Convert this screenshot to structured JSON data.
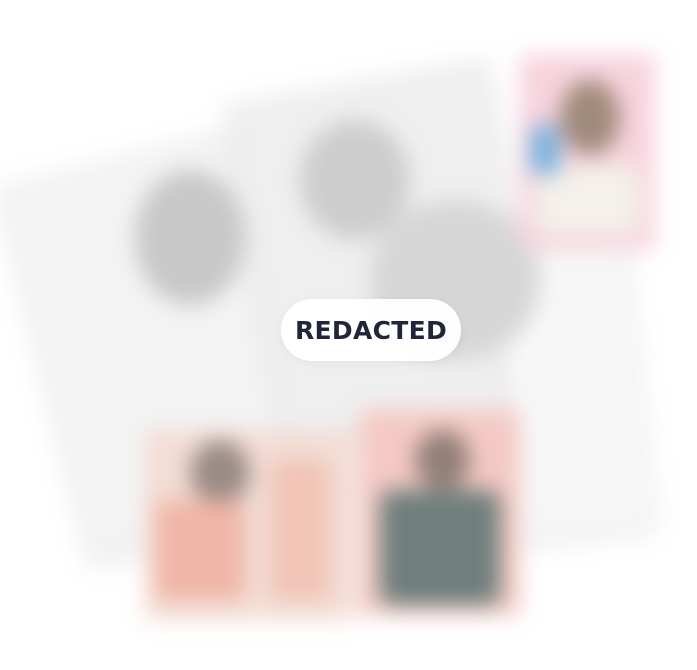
{
  "overlay": {
    "label": "REDACTED"
  },
  "colors": {
    "label_text": "#1f2637",
    "pill_background": "#ffffff",
    "page_background": "#ffffff"
  }
}
